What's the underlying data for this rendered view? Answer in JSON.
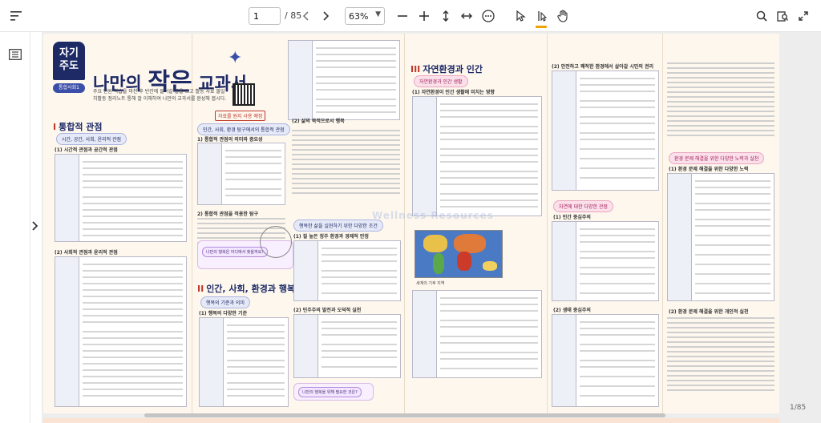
{
  "toolbar": {
    "current_page": "1",
    "total_pages": "/ 85",
    "zoom": "63%"
  },
  "document": {
    "badge_line1": "자기",
    "badge_line2": "주도",
    "badge_sub": "통합사회1",
    "title_prefix": "나만의 ",
    "title_big": "작은",
    "title_suffix": " 교과서",
    "intro_text": "주요 단원 학습을 마친 후 빈칸에 들어갈 말을 쓰고 활동 자료 불일치활동 정리노트 통해 잘 이해하여 나만의 교과서를 완성해 봅시다.",
    "source_tag": "자료를 원지 사용 예정",
    "sections": {
      "s1": "통합적 관점",
      "s1_roman": "I",
      "s2": "인간, 사회, 환경과 행복",
      "s2_roman": "II",
      "s3": "자연환경과 인간",
      "s3_roman": "III"
    },
    "pills": {
      "p1": "시간, 공간, 사회, 윤리적 관점",
      "p2": "인간, 사회, 환경 탐구에서의 통합적 관점",
      "p3": "행복의 기준과 의미",
      "p4": "행복한 삶을 실현하기 위한 다양한 조건",
      "p5": "자연환경과 인간 생활",
      "p6": "자연에 대한 다양한 관점",
      "p7": "환경 문제 해결을 위한 다양한 노력과 실천"
    },
    "subheads": {
      "a": "(1) 시간적 관점과 공간적 관점",
      "b": "(2) 사회적 관점과 윤리적 관점",
      "c": "1) 통합적 관점의 의미와 중요성",
      "d": "2) 통합적 관점을 적용한 탐구",
      "e": "(1) 행복의 다양한 기준",
      "f": "(2) 삶의 목적으로서 행복",
      "g": "(1) 질 높은 정주 환경과 경제적 안정",
      "h": "(2) 민주주의 발전과 도덕적 실천",
      "i": "(1) 자연환경이 인간 생활에 미치는 영향",
      "j": "(2) 안전하고 쾌적한 환경에서 살아갈 시민의 권리",
      "k": "(1) 인간 중심주의",
      "l": "(2) 생태 중심주의",
      "m": "(1) 환경 문제 해결을 위한 다양한 노력",
      "n": "(2) 환경 문제 해결을 위한 개인적 실천"
    },
    "bars": {
      "b1": "나만의 행복은 어디에서 찾을까요?",
      "b2": "나만의 행복을 위해 필요한 것은?"
    },
    "map_caption": "세계의 기후 지역",
    "watermark": "Wellness Resources",
    "page_counter": "1/85"
  },
  "icons": [
    "menu-icon",
    "outline-icon",
    "chevron-left-icon",
    "chevron-right-icon",
    "minus-icon",
    "plus-icon",
    "fit-height-icon",
    "fit-width-icon",
    "more-icon",
    "pointer-icon",
    "text-select-icon",
    "hand-icon",
    "search-icon",
    "thumbnails-icon",
    "fullscreen-icon",
    "expand-sidebar-icon"
  ],
  "colors": {
    "accent": "#1e2a66",
    "highlight": "#f0a000",
    "section_red": "#c0392b",
    "page_bg": "#fdf7ee"
  }
}
